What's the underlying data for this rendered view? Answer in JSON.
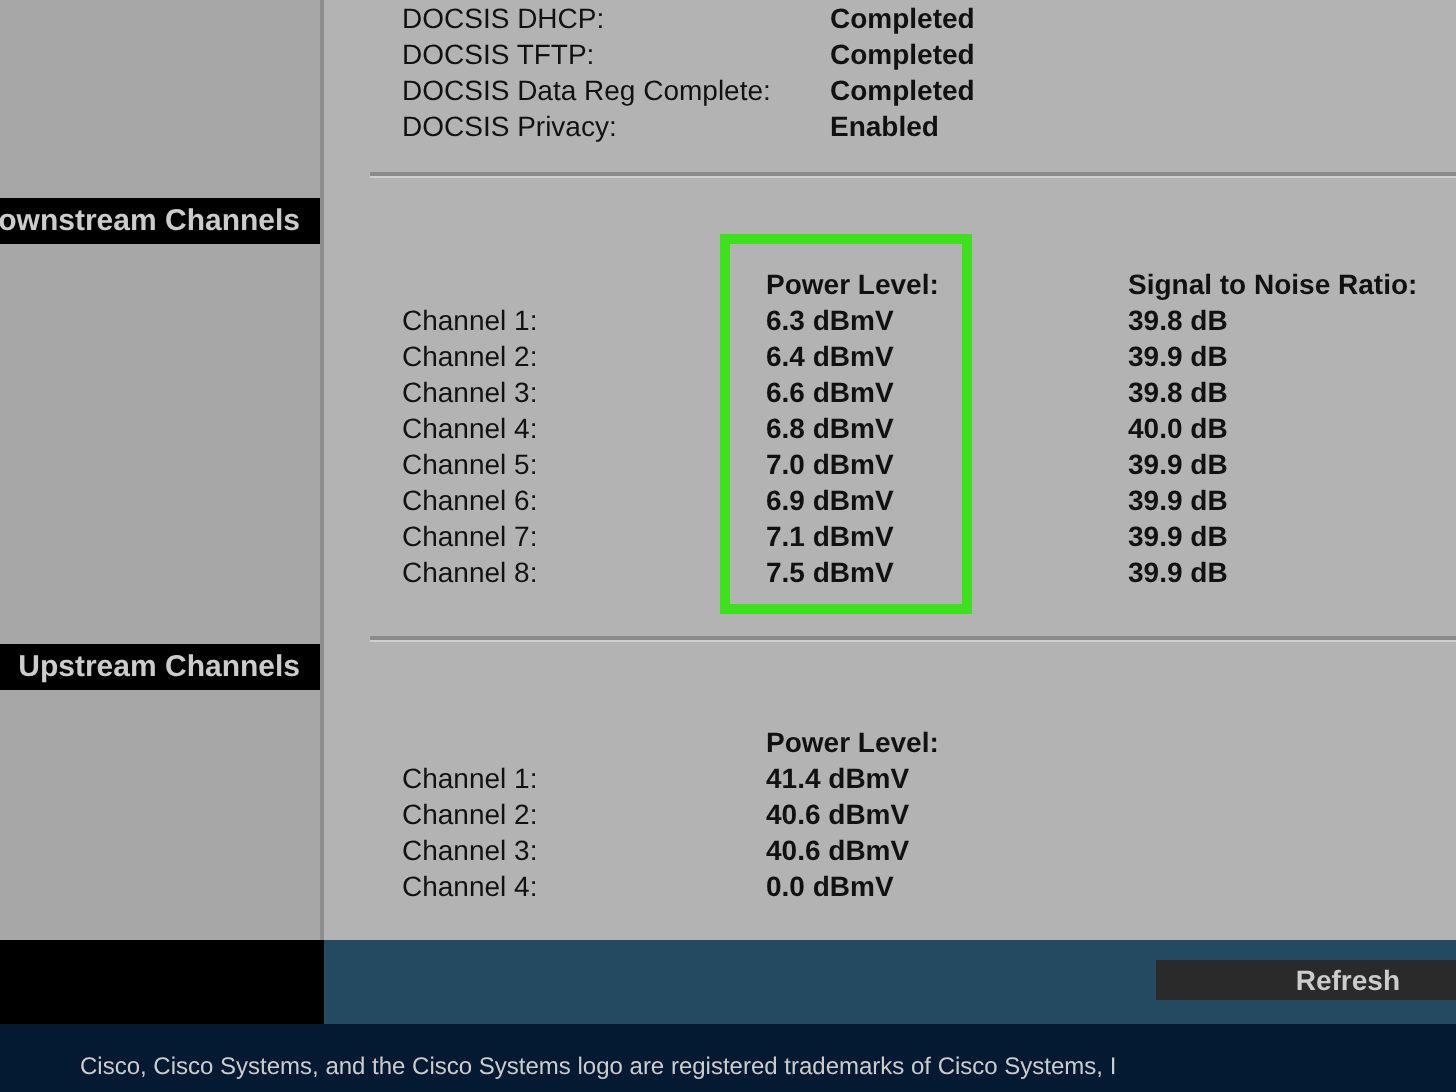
{
  "status_rows": [
    {
      "label": "DOCSIS DHCP:",
      "value": "Completed"
    },
    {
      "label": "DOCSIS TFTP:",
      "value": "Completed"
    },
    {
      "label": "DOCSIS Data Reg Complete:",
      "value": "Completed"
    },
    {
      "label": "DOCSIS Privacy:",
      "value": "Enabled"
    }
  ],
  "downstream": {
    "heading": "ownstream Channels",
    "columns": [
      "",
      "Power Level:",
      "Signal to Noise Ratio:"
    ],
    "highlighted": true,
    "rows": [
      [
        "Channel 1:",
        "6.3 dBmV",
        "39.8 dB"
      ],
      [
        "Channel 2:",
        "6.4 dBmV",
        "39.9 dB"
      ],
      [
        "Channel 3:",
        "6.6 dBmV",
        "39.8 dB"
      ],
      [
        "Channel 4:",
        "6.8 dBmV",
        "40.0 dB"
      ],
      [
        "Channel 5:",
        "7.0 dBmV",
        "39.9 dB"
      ],
      [
        "Channel 6:",
        "6.9 dBmV",
        "39.9 dB"
      ],
      [
        "Channel 7:",
        "7.1 dBmV",
        "39.9 dB"
      ],
      [
        "Channel 8:",
        "7.5 dBmV",
        "39.9 dB"
      ]
    ]
  },
  "upstream": {
    "heading": "Upstream Channels",
    "columns": [
      "",
      "Power Level:"
    ],
    "rows": [
      [
        "Channel 1:",
        "41.4 dBmV"
      ],
      [
        "Channel 2:",
        "40.6 dBmV"
      ],
      [
        "Channel 3:",
        "40.6 dBmV"
      ],
      [
        "Channel 4:",
        "0.0 dBmV"
      ]
    ]
  },
  "refresh_button": "Refresh",
  "footer": "Cisco, Cisco Systems, and the Cisco Systems logo are registered trademarks of Cisco Systems, I"
}
